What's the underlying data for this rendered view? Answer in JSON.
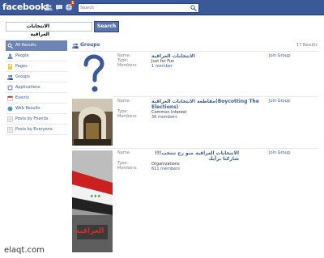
{
  "header": {
    "logo": "facebook",
    "notification_count": "1",
    "search_placeholder": "Search"
  },
  "search": {
    "query": "الانتخابات العراقية",
    "button_label": "Search"
  },
  "sidebar": {
    "items": [
      {
        "label": "All Results",
        "icon": "magnifier-icon",
        "active": true
      },
      {
        "label": "People",
        "icon": "person-icon"
      },
      {
        "label": "Pages",
        "icon": "pages-icon"
      },
      {
        "label": "Groups",
        "icon": "groups-icon"
      },
      {
        "label": "Applications",
        "icon": "applications-icon"
      },
      {
        "label": "Events",
        "icon": "events-icon"
      },
      {
        "label": "Web Results",
        "icon": "globe-icon"
      },
      {
        "label": "Posts by Friends",
        "icon": "posts-friends-icon"
      },
      {
        "label": "Posts by Everyone",
        "icon": "posts-everyone-icon"
      }
    ]
  },
  "results": {
    "title": "Groups",
    "count": "17 Results",
    "field_labels": {
      "name": "Name:",
      "type": "Type:",
      "members": "Members:"
    },
    "rows": [
      {
        "name": "الانتخابات العراقية",
        "type": "Just for Fun",
        "members": "1 member",
        "action": "Join Group",
        "thumb": "question-mark"
      },
      {
        "name": "مقاطعة الانتخابات العراقية(Boycotting The Elections)",
        "type": "Common Interest",
        "members": "36 members",
        "action": "Join Group",
        "thumb": "shrine-photo"
      },
      {
        "name": "الانتخابات العراقية منو رح تنتخب!!! شاركنا برأيك",
        "type": "Organizations",
        "members": "611 members",
        "action": "Join Group",
        "thumb": "iraq-flag-poster"
      }
    ]
  },
  "poster": {
    "text": "العراقية"
  },
  "watermark": "elaqt.com",
  "colors": {
    "brand": "#3b5998",
    "active": "#6d84b4",
    "border": "#e9e9e9"
  }
}
